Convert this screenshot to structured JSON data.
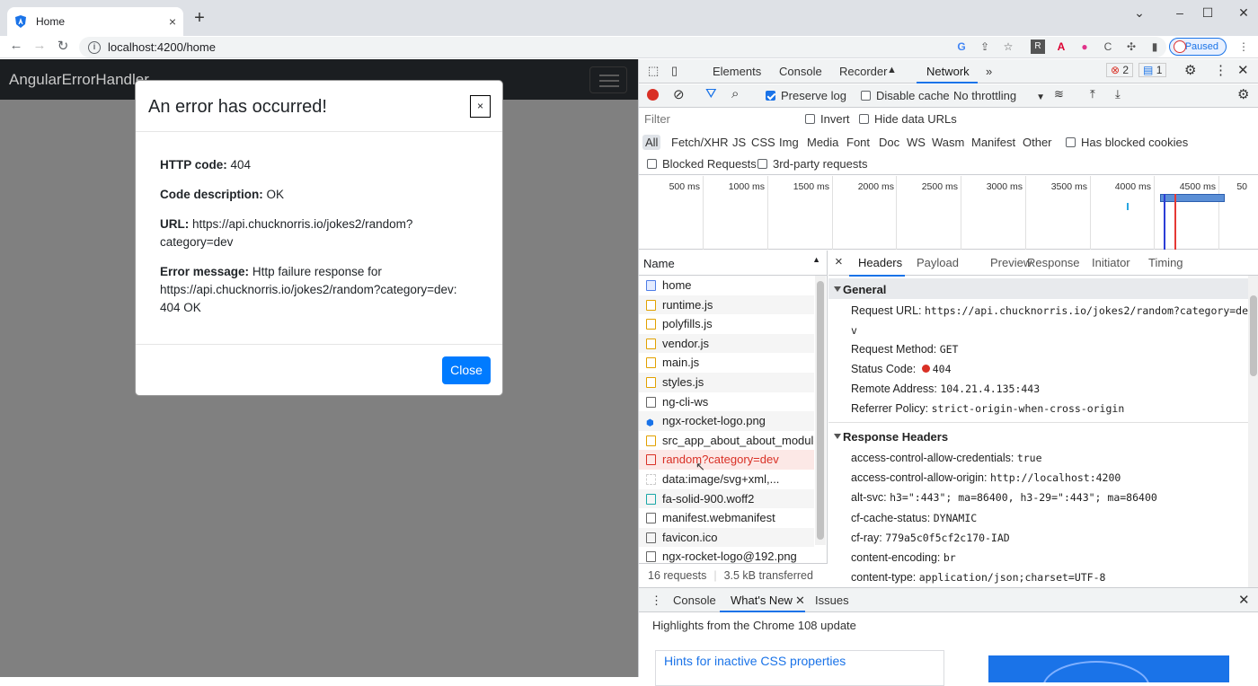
{
  "browser": {
    "tab_title": "Home",
    "tab_close": "×",
    "new_tab": "+",
    "url": "localhost:4200/home",
    "profile_status": "Paused",
    "window_controls": [
      "⌄",
      "–",
      "☐",
      "✕"
    ]
  },
  "app": {
    "brand": "AngularErrorHandler"
  },
  "modal": {
    "title": "An error has occurred!",
    "close_x": "×",
    "http_code_label": "HTTP code:",
    "http_code": "404",
    "code_desc_label": "Code description:",
    "code_desc": "OK",
    "url_label": "URL:",
    "url": "https://api.chucknorris.io/jokes2/random?category=dev",
    "error_label": "Error message:",
    "error_message": "Http failure response for https://api.chucknorris.io/jokes2/random?category=dev: 404 OK",
    "close_button": "Close"
  },
  "devtools": {
    "tabs": [
      "Elements",
      "Console",
      "Recorder",
      "Network"
    ],
    "active_tab": "Network",
    "more": "»",
    "error_count": "2",
    "message_count": "1",
    "toolbar": {
      "preserve_log": "Preserve log",
      "disable_cache": "Disable cache",
      "throttling": "No throttling"
    },
    "filter_placeholder": "Filter",
    "invert": "Invert",
    "hide_data_urls": "Hide data URLs",
    "types": [
      "All",
      "Fetch/XHR",
      "JS",
      "CSS",
      "Img",
      "Media",
      "Font",
      "Doc",
      "WS",
      "Wasm",
      "Manifest",
      "Other"
    ],
    "has_blocked_cookies": "Has blocked cookies",
    "blocked_requests": "Blocked Requests",
    "third_party": "3rd-party requests",
    "timeline_ticks": [
      "500 ms",
      "1000 ms",
      "1500 ms",
      "2000 ms",
      "2500 ms",
      "3000 ms",
      "3500 ms",
      "4000 ms",
      "4500 ms",
      "50"
    ],
    "name_header": "Name",
    "requests": [
      {
        "name": "home",
        "type": "doc"
      },
      {
        "name": "runtime.js",
        "type": "js"
      },
      {
        "name": "polyfills.js",
        "type": "js"
      },
      {
        "name": "vendor.js",
        "type": "js"
      },
      {
        "name": "main.js",
        "type": "js"
      },
      {
        "name": "styles.js",
        "type": "js"
      },
      {
        "name": "ng-cli-ws",
        "type": "other"
      },
      {
        "name": "ngx-rocket-logo.png",
        "type": "img"
      },
      {
        "name": "src_app_about_about_module_",
        "type": "js"
      },
      {
        "name": "random?category=dev",
        "type": "error"
      },
      {
        "name": "data:image/svg+xml,...",
        "type": "data"
      },
      {
        "name": "fa-solid-900.woff2",
        "type": "font"
      },
      {
        "name": "manifest.webmanifest",
        "type": "other"
      },
      {
        "name": "favicon.ico",
        "type": "other"
      },
      {
        "name": "ngx-rocket-logo@192.png",
        "type": "other"
      }
    ],
    "request_count": "16 requests",
    "transferred": "3.5 kB transferred",
    "detail_close": "×",
    "detail_tabs": [
      "Headers",
      "Payload",
      "Preview",
      "Response",
      "Initiator",
      "Timing"
    ],
    "general": {
      "title": "General",
      "request_url_label": "Request URL:",
      "request_url": "https://api.chucknorris.io/jokes2/random?category=de",
      "request_url_wrap": "v",
      "method_label": "Request Method:",
      "method": "GET",
      "status_label": "Status Code:",
      "status": "404",
      "remote_label": "Remote Address:",
      "remote": "104.21.4.135:443",
      "referrer_label": "Referrer Policy:",
      "referrer": "strict-origin-when-cross-origin"
    },
    "response_headers": {
      "title": "Response Headers",
      "items": [
        {
          "k": "access-control-allow-credentials:",
          "v": "true"
        },
        {
          "k": "access-control-allow-origin:",
          "v": "http://localhost:4200"
        },
        {
          "k": "alt-svc:",
          "v": "h3=\":443\"; ma=86400, h3-29=\":443\"; ma=86400"
        },
        {
          "k": "cf-cache-status:",
          "v": "DYNAMIC"
        },
        {
          "k": "cf-ray:",
          "v": "779a5c0f5cf2c170-IAD"
        },
        {
          "k": "content-encoding:",
          "v": "br"
        },
        {
          "k": "content-type:",
          "v": "application/json;charset=UTF-8"
        }
      ]
    },
    "drawer": {
      "tabs": [
        "Console",
        "What's New",
        "Issues"
      ],
      "active": "What's New",
      "highlights": "Highlights from the Chrome 108 update",
      "hint_title": "Hints for inactive CSS properties"
    },
    "status_color": "#d93025",
    "accent": "#1a73e8"
  }
}
